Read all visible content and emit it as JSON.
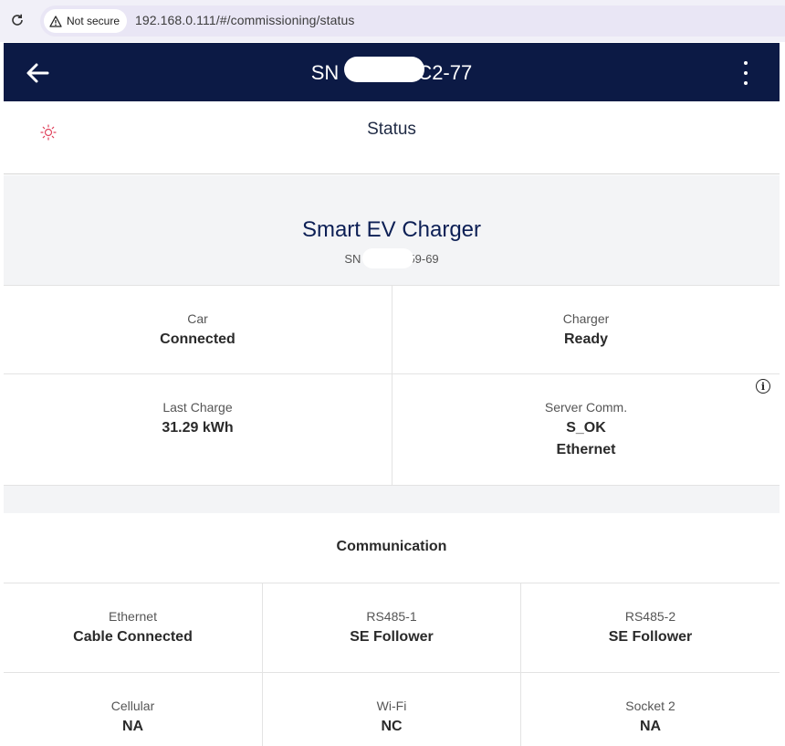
{
  "browser": {
    "security_label": "Not secure",
    "url": "192.168.0.111/#/commissioning/status"
  },
  "header": {
    "title_prefix": "SN",
    "title_suffix": "C2-77"
  },
  "status_strip": {
    "title": "Status"
  },
  "device": {
    "name": "Smart EV Charger",
    "sn_prefix": "SN",
    "sn_suffix": "59-69"
  },
  "status_tiles": [
    {
      "label": "Car",
      "value": "Connected"
    },
    {
      "label": "Charger",
      "value": "Ready"
    },
    {
      "label": "Last Charge",
      "value": "31.29 kWh"
    },
    {
      "label": "Server Comm.",
      "value": "S_OK",
      "value2": "Ethernet"
    }
  ],
  "communication": {
    "title": "Communication",
    "tiles": [
      {
        "label": "Ethernet",
        "value": "Cable Connected"
      },
      {
        "label": "RS485-1",
        "value": "SE Follower"
      },
      {
        "label": "RS485-2",
        "value": "SE Follower"
      },
      {
        "label": "Cellular",
        "value": "NA"
      },
      {
        "label": "Wi-Fi",
        "value": "NC"
      },
      {
        "label": "Socket 2",
        "value": "NA"
      }
    ]
  },
  "icons": {
    "reload": "reload-icon",
    "warning": "warning-icon",
    "back": "arrow-back-icon",
    "more": "more-vert-icon",
    "status": "sun-icon",
    "info": "info-icon"
  },
  "colors": {
    "header_bg": "#0c1a45",
    "device_name": "#0c1f55",
    "status_icon": "#e0455f"
  }
}
